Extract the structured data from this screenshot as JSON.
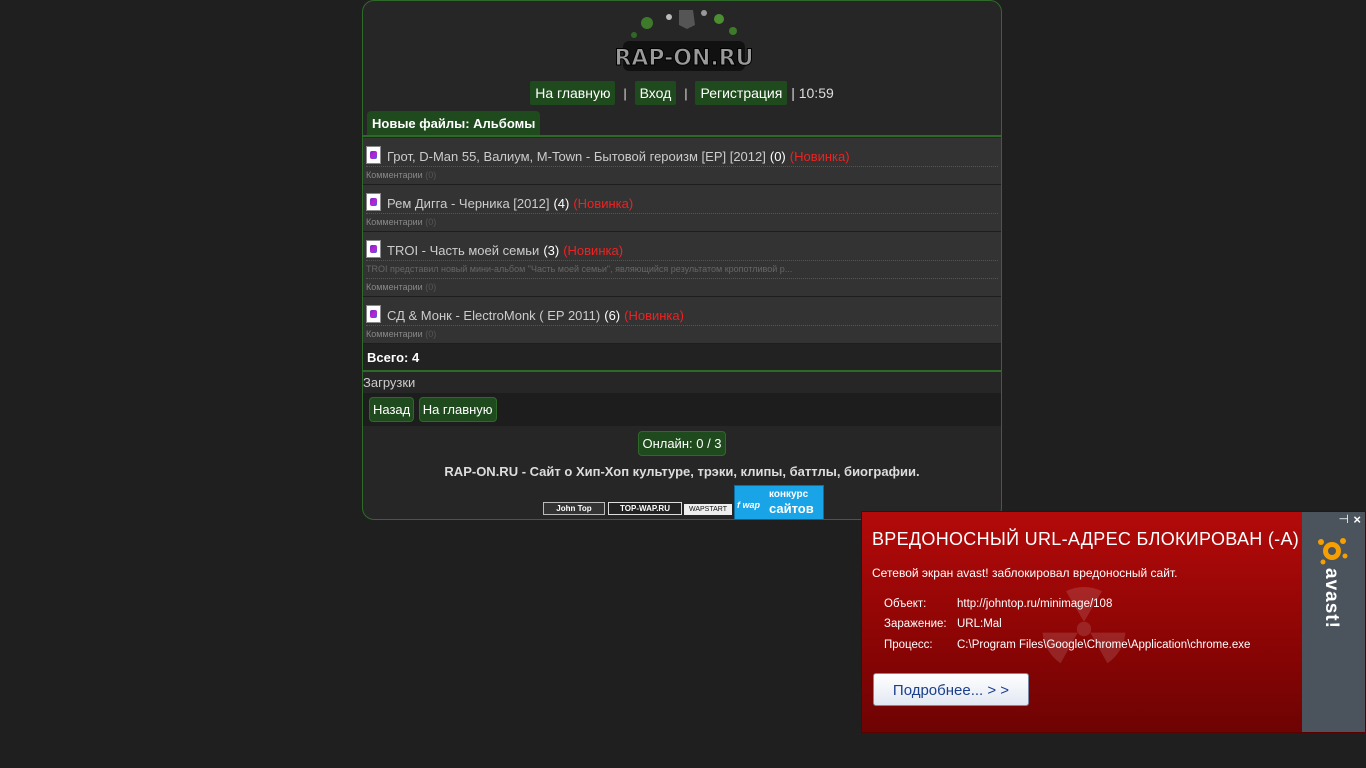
{
  "site": {
    "logo_text": "RAP-ON.RU",
    "nav": {
      "home": "На главную",
      "login": "Вход",
      "register": "Регистрация",
      "separator": "|",
      "time": "| 10:59"
    },
    "section_title": "Новые файлы: Альбомы",
    "items": [
      {
        "title": "Грот, D-Man 55, Валиум, M-Town - Бытовой героизм [EP] [2012]",
        "count": "(0)",
        "badge": "(Новинка)",
        "desc": "",
        "comments_label": "Комментарии",
        "comments_count": "(0)"
      },
      {
        "title": "Рем Дигга - Черника [2012]",
        "count": "(4)",
        "badge": "(Новинка)",
        "desc": "",
        "comments_label": "Комментарии",
        "comments_count": "(0)"
      },
      {
        "title": "TROI - Часть моей семьи",
        "count": "(3)",
        "badge": "(Новинка)",
        "desc": "TROI представил новый мини-альбом \"Часть моей семьи\", являющийся результатом кропотливой р...",
        "comments_label": "Комментарии",
        "comments_count": "(0)"
      },
      {
        "title": "СД & Монк - ElectroMonk ( EP 2011)",
        "count": "(6)",
        "badge": "(Новинка)",
        "desc": "",
        "comments_label": "Комментарии",
        "comments_count": "(0)"
      }
    ],
    "total": "Всего: 4",
    "downloads": "Загрузки",
    "back": "Назад",
    "home2": "На главную",
    "online": "Онлайн: 0 / 3",
    "footer": "RAP-ON.RU - Сайт о Хип-Хоп культуре, трэки, клипы, баттлы, биографии.",
    "counters": {
      "johntop": "John Top",
      "topwap": "TOP-WAP.RU",
      "wapstart": "WAPSTART",
      "fwap_line1": "конкурс",
      "fwap_line2": "сайтов",
      "fwap_prefix": "f wap"
    }
  },
  "avast": {
    "title": "ВРЕДОНОСНЫЙ URL-АДРЕС БЛОКИРОВАН (-А)",
    "subtitle": "Сетевой экран avast! заблокировал вредоносный сайт.",
    "object_label": "Объект:",
    "object_value": "http://johntop.ru/minimage/108",
    "infection_label": "Заражение:",
    "infection_value": "URL:Mal",
    "process_label": "Процесс:",
    "process_value": "C:\\Program Files\\Google\\Chrome\\Application\\chrome.exe",
    "more_button": "Подробнее... > >",
    "brand": "avast!",
    "close": "×",
    "pin": "⊣"
  },
  "colors": {
    "accent_green": "#1f4a1d",
    "new_red": "#e22222",
    "avast_red": "#b40a0a"
  }
}
